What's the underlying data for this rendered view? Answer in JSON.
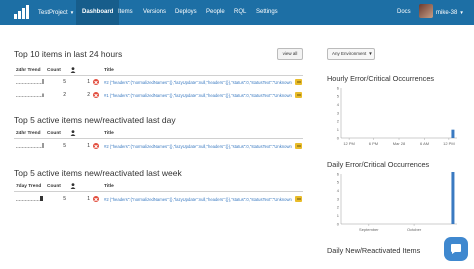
{
  "nav": {
    "project": "TestProject",
    "items": [
      {
        "label": "Dashboard"
      },
      {
        "label": "Items"
      },
      {
        "label": "Versions"
      },
      {
        "label": "Deploys"
      },
      {
        "label": "People"
      },
      {
        "label": "RQL"
      },
      {
        "label": "Settings"
      }
    ],
    "docs": "Docs",
    "user": "mike-38"
  },
  "section_top10": {
    "title": "Top 10 items in last 24 hours",
    "view_all": "view all",
    "headers": {
      "trend": "24hr Trend",
      "count": "Count",
      "title": "Title"
    },
    "rows": [
      {
        "count": "5",
        "users": "1",
        "title": "#2 {\"headers\":{\"normalizedNames\":{},\"lazyUpdate\":null,\"headers\":{}},\"status\":0,\"statusText\":\"Unknown Error\",\"url\":nul…"
      },
      {
        "count": "2",
        "users": "2",
        "title": "#1 {\"headers\":{\"normalizedNames\":{},\"lazyUpdate\":null,\"headers\":{}},\"status\":0,\"statusText\":\"Unknown Error\",\"url\":nul…"
      }
    ]
  },
  "section_new_day": {
    "title": "Top 5 active items new/reactivated last day",
    "headers": {
      "trend": "24hr Trend",
      "count": "Count",
      "title": "Title"
    },
    "rows": [
      {
        "count": "5",
        "users": "1",
        "title": "#2 {\"headers\":{\"normalizedNames\":{},\"lazyUpdate\":null,\"headers\":{}},\"status\":0,\"statusText\":\"Unknown Error\",\"url\":nul…"
      }
    ]
  },
  "section_new_week": {
    "title": "Top 5 active items new/reactivated last week",
    "headers": {
      "trend": "7day Trend",
      "count": "Count",
      "title": "Title"
    },
    "rows": [
      {
        "count": "5",
        "users": "1",
        "title": "#2 {\"headers\":{\"normalizedNames\":{},\"lazyUpdate\":null,\"headers\":{}},\"status\":0,\"statusText\":\"Unknown Error\",\"url\":nul…"
      }
    ]
  },
  "environment_select": "Any Environment",
  "charts": {
    "hourly_title": "Hourly Error/Critical Occurrences",
    "daily_title": "Daily Error/Critical Occurrences",
    "new_title": "Daily New/Reactivated Items",
    "bar_color": "#3a7ac1"
  },
  "chart_data": [
    {
      "type": "bar",
      "title": "Hourly Error/Critical Occurrences",
      "x_tick_labels": [
        "12 PM",
        "6 PM",
        "Mar 28",
        "6 AM",
        "12 PM"
      ],
      "y_tick_labels": [
        "0",
        "1",
        "2",
        "3",
        "4",
        "5",
        "6"
      ],
      "ylim": [
        0,
        6
      ],
      "series": [
        {
          "values": [
            {
              "x": "last hour",
              "y": 1
            }
          ]
        }
      ]
    },
    {
      "type": "bar",
      "title": "Daily Error/Critical Occurrences",
      "x_tick_labels": [
        "September",
        "October"
      ],
      "y_tick_labels": [
        "0",
        "1",
        "2",
        "3",
        "4",
        "5",
        "6"
      ],
      "ylim": [
        0,
        6
      ],
      "series": [
        {
          "values": [
            {
              "x": "today",
              "y": 7
            }
          ]
        }
      ]
    }
  ]
}
